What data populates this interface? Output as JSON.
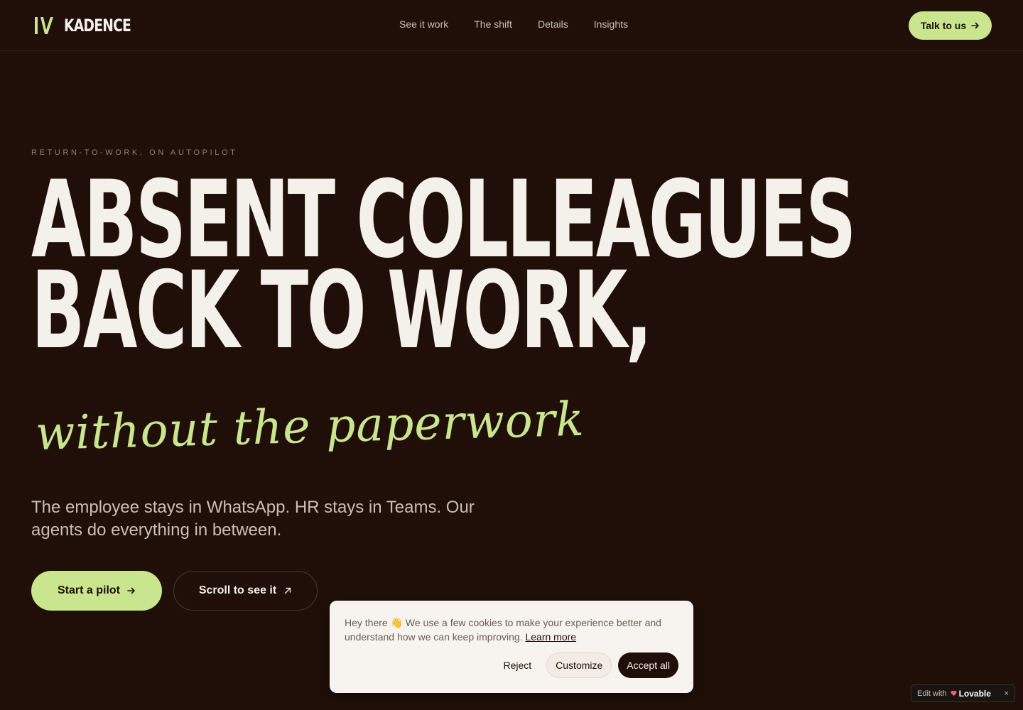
{
  "brand": {
    "name": "KADENCE",
    "accent_color": "#c9e58d",
    "background_color": "#1f0f08"
  },
  "nav": {
    "items": [
      {
        "label": "See it work"
      },
      {
        "label": "The shift"
      },
      {
        "label": "Details"
      },
      {
        "label": "Insights"
      }
    ],
    "cta_label": "Talk to us"
  },
  "hero": {
    "eyebrow": "RETURN-TO-WORK, ON AUTOPILOT",
    "headline_line1": "ABSENT COLLEAGUES",
    "headline_line2": "BACK TO WORK,",
    "script_line": "without the paperwork",
    "subtext": "The employee stays in WhatsApp. HR stays in Teams. Our agents do everything in between.",
    "primary_cta": "Start a pilot",
    "secondary_cta": "Scroll to see it"
  },
  "cookie_banner": {
    "message": "Hey there",
    "wave": "👋",
    "message_rest": "We use a few cookies to make your experience better and understand how we can keep improving.",
    "learn_more": "Learn more",
    "reject": "Reject",
    "customize": "Customize",
    "accept": "Accept all"
  },
  "badge": {
    "prefix": "Edit with",
    "brand": "Lovable",
    "close": "×"
  }
}
